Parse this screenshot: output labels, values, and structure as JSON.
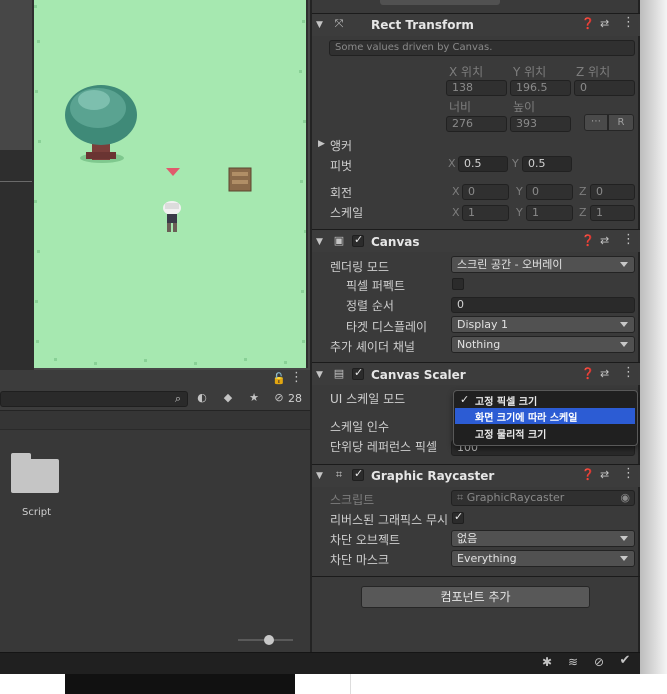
{
  "project": {
    "count_badge": "28",
    "folder_label": "Script"
  },
  "inspector": {
    "rect_transform": {
      "title": "Rect Transform",
      "driven_note": "Some values driven by Canvas.",
      "pos_x_label": "X 위치",
      "pos_y_label": "Y 위치",
      "pos_z_label": "Z 위치",
      "pos_x": "138",
      "pos_y": "196.5",
      "pos_z": "0",
      "width_label": "너비",
      "height_label": "높이",
      "width": "276",
      "height": "393",
      "r_button": "R",
      "anchors_label": "앵커",
      "pivot_label": "피벗",
      "pivot_x": "0.5",
      "pivot_y": "0.5",
      "rotation_label": "회전",
      "rot_x": "0",
      "rot_y": "0",
      "rot_z": "0",
      "scale_label": "스케일",
      "scale_x": "1",
      "scale_y": "1",
      "scale_z": "1",
      "axis_x": "X",
      "axis_y": "Y",
      "axis_z": "Z"
    },
    "canvas": {
      "title": "Canvas",
      "render_mode_label": "렌더링 모드",
      "render_mode": "스크린 공간 - 오버레이",
      "pixel_perfect_label": "픽셀 퍼펙트",
      "sort_order_label": "정렬 순서",
      "sort_order": "0",
      "target_display_label": "타겟 디스플레이",
      "target_display": "Display 1",
      "shader_channels_label": "추가 셰이더 채널",
      "shader_channels": "Nothing"
    },
    "canvas_scaler": {
      "title": "Canvas Scaler",
      "ui_scale_mode_label": "UI 스케일 모드",
      "scale_factor_label": "스케일 인수",
      "ref_pixels_label": "단위당 레퍼런스 픽셀",
      "ref_pixels": "100",
      "dropdown_options": [
        "고정 픽셀 크기",
        "화면 크기에 따라 스케일",
        "고정 물리적 크기"
      ],
      "selected_option": "고정 픽셀 크기",
      "highlighted_option": "화면 크기에 따라 스케일"
    },
    "graphic_raycaster": {
      "title": "Graphic Raycaster",
      "script_label": "스크립트",
      "script_value": "GraphicRaycaster",
      "ignore_reversed_label": "리버스된 그래픽스 무시",
      "blocking_objects_label": "차단 오브젝트",
      "blocking_objects": "없음",
      "blocking_mask_label": "차단 마스크",
      "blocking_mask": "Everything"
    },
    "add_component": "컴포넌트 추가"
  },
  "icons": [
    "lock-icon",
    "kebab-menu-icon",
    "help-icon",
    "preset-icon",
    "search-icon",
    "tag-icon",
    "star-icon",
    "eye-slash-icon",
    "folder-icon",
    "bug-icon",
    "stack-icon",
    "visibility-icon",
    "check-circle-icon",
    "rect-transform-icon",
    "canvas-icon",
    "canvas-scaler-icon",
    "raycaster-icon"
  ],
  "colors": {
    "scene_grass": "#a6e8b0",
    "editor_dark": "#383838",
    "selection_blue": "#2c5cd4"
  }
}
